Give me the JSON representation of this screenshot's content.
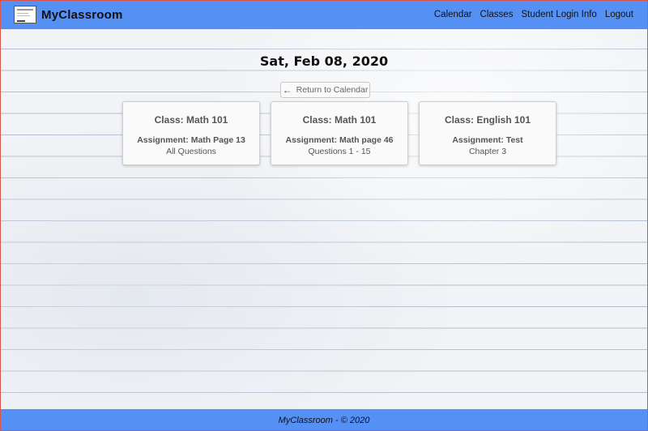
{
  "navbar": {
    "brand": "MyClassroom",
    "links": [
      "Calendar",
      "Classes",
      "Student Login Info",
      "Logout"
    ]
  },
  "page": {
    "date_title": "Sat, Feb 08, 2020",
    "return_label": "Return to Calendar"
  },
  "cards": [
    {
      "class": "Class: Math 101",
      "assignment": "Assignment: Math Page 13",
      "detail": "All Questions"
    },
    {
      "class": "Class: Math 101",
      "assignment": "Assignment: Math page 46",
      "detail": "Questions 1 - 15"
    },
    {
      "class": "Class: English 101",
      "assignment": "Assignment: Test",
      "detail": "Chapter 3"
    }
  ],
  "footer": {
    "text": "MyClassroom - © 2020"
  },
  "colors": {
    "navbar": "#5591f4",
    "footer": "#5591f4"
  },
  "icons": {
    "brand": "classroom-logo-icon",
    "return": "arrow-left-icon"
  }
}
